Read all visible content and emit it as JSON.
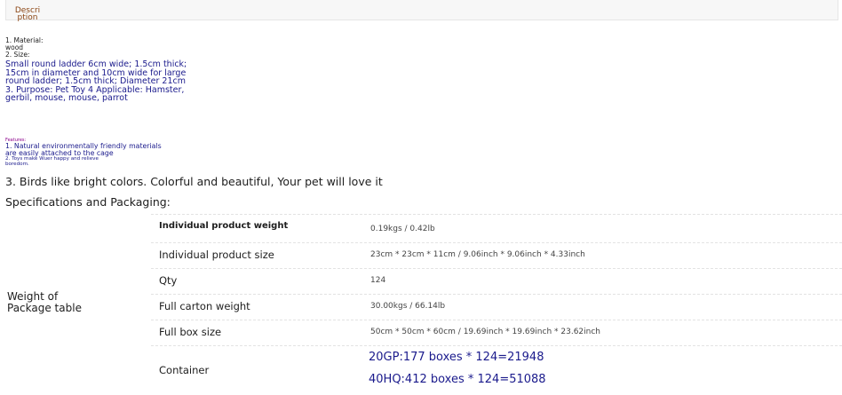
{
  "tab": {
    "label": "Description",
    "line1": "Descri",
    "line2": "ption"
  },
  "description": {
    "material_label": "1. Material:",
    "material_value": "wood",
    "size_label": "2. Size:",
    "size_text": "Small round ladder 6cm wide; 1.5cm thick; 15cm in diameter and 10cm wide for large round ladder; 1.5cm thick; Diameter 21cm 3. Purpose: Pet Toy 4 Applicable: Hamster, gerbil, mouse, mouse, parrot"
  },
  "features": {
    "label": "Features:",
    "item1": "1. Natural environmentally friendly materials are easily attached to the cage",
    "item2": "2. Toys make Wuer happy and relieve boredom.",
    "item3": "3. Birds like bright colors. Colorful and beautiful, Your pet will love it"
  },
  "specifications": {
    "title": "Specifications and Packaging:",
    "group_label": "Weight of Package table",
    "rows": [
      {
        "name": "Individual product weight",
        "value": "0.19kgs / 0.42lb"
      },
      {
        "name": "Individual product size",
        "value": "23cm * 23cm * 11cm / 9.06inch * 9.06inch * 4.33inch"
      },
      {
        "name": "Qty",
        "value": "124"
      },
      {
        "name": "Full carton weight",
        "value": "30.00kgs / 66.14lb"
      },
      {
        "name": "Full box size",
        "value": "50cm * 50cm * 60cm / 19.69inch * 19.69inch * 23.62inch"
      },
      {
        "name": "Container",
        "value_lines": [
          "20GP:177 boxes * 124=21948",
          "40HQ:412 boxes * 124=51088"
        ]
      }
    ]
  },
  "colors": {
    "tab_text": "#8b4513",
    "blue_text": "#1a1a8c",
    "features_label": "#8b008b"
  }
}
